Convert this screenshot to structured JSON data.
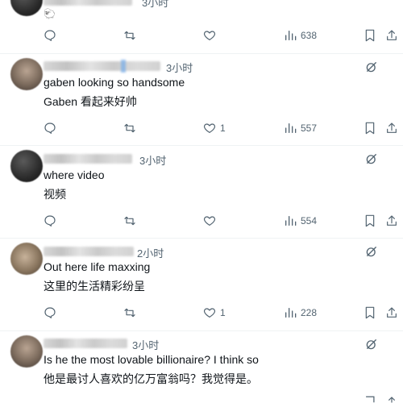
{
  "posts": [
    {
      "time": "3小时",
      "lines": [],
      "likes": "",
      "views": "638"
    },
    {
      "time": "3小时",
      "lines": [
        "gaben looking so handsome",
        "Gaben 看起来好帅"
      ],
      "likes": "1",
      "views": "557"
    },
    {
      "time": "3小时",
      "lines": [
        "where video",
        "视频"
      ],
      "likes": "",
      "views": "554"
    },
    {
      "time": "2小时",
      "lines": [
        "Out here life maxxing",
        "这里的生活精彩纷呈"
      ],
      "likes": "1",
      "views": "228"
    },
    {
      "time": "3小时",
      "lines": [
        "Is he the most lovable billionaire? I think so",
        "他是最讨人喜欢的亿万富翁吗？我觉得是。"
      ],
      "likes": "",
      "views": ""
    }
  ],
  "icons": {
    "reply": "reply-icon",
    "repost": "repost-icon",
    "like": "like-icon",
    "views": "views-icon",
    "bookmark": "bookmark-icon",
    "share": "share-icon",
    "grok": "grok-icon"
  },
  "colors": {
    "text": "#0f1419",
    "muted": "#536471",
    "divider": "#eff3f4",
    "background": "#ffffff"
  }
}
